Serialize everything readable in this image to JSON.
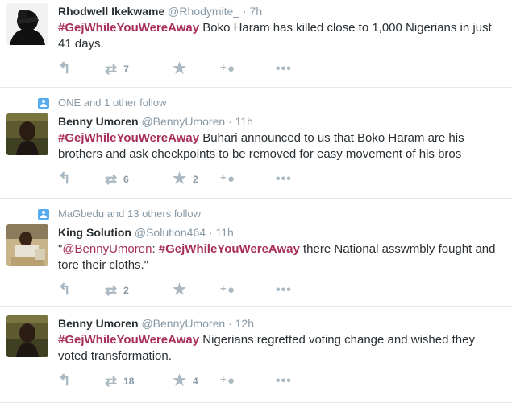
{
  "tweets": [
    {
      "context": "",
      "fullname": "Rhodwell Ikekwame",
      "username": "@Rhodymite_",
      "dot": "·",
      "time": "7h",
      "hashtag": "#GejWhileYouWereAway",
      "text": " Boko Haram has killed close to 1,000 Nigerians in just 41 days.",
      "retweets": "7",
      "favorites": ""
    },
    {
      "context": "ONE and 1 other follow",
      "fullname": "Benny Umoren",
      "username": "@BennyUmoren",
      "dot": "·",
      "time": "11h",
      "hashtag": "#GejWhileYouWereAway",
      "text": " Buhari announced to us that Boko Haram are his brothers and ask checkpoints to be removed for easy movement of his bros",
      "retweets": "6",
      "favorites": "2"
    },
    {
      "context": "MaGbedu and 13 others follow",
      "fullname": "King Solution",
      "username": "@Solution464",
      "dot": "·",
      "time": "11h",
      "quote_open": "\"",
      "mention": "@BennyUmoren",
      "colon": ": ",
      "hashtag": "#GejWhileYouWereAway",
      "text": " there National asswmbly fought and tore their cloths.\"",
      "retweets": "2",
      "favorites": ""
    },
    {
      "context": "",
      "fullname": "Benny Umoren",
      "username": "@BennyUmoren",
      "dot": "·",
      "time": "12h",
      "hashtag": "#GejWhileYouWereAway",
      "text": " Nigerians regretted voting change and wished they voted transformation.",
      "retweets": "18",
      "favorites": "4"
    }
  ],
  "icons": {
    "reply": "reply-icon",
    "retweet": "retweet-icon",
    "favorite": "star-icon",
    "follow": "follow-user-icon",
    "more": "more-dots-icon",
    "context": "person-icon"
  },
  "colors": {
    "hashtag": "#a82f5c",
    "secondary_text": "#8899a6",
    "icon": "#aab8c2",
    "context_icon": "#55acee",
    "divider": "#e1e8ed"
  }
}
